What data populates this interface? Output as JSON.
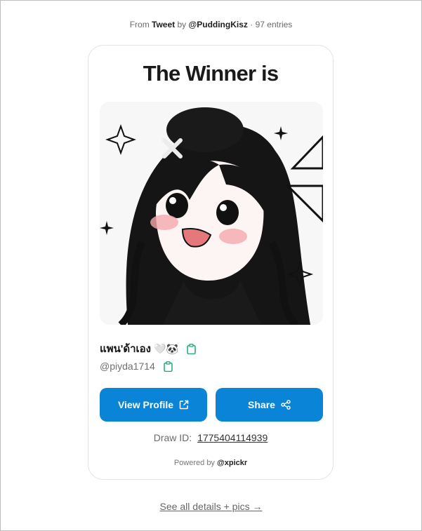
{
  "source": {
    "prefix": "From",
    "link_label": "Tweet",
    "by": "by",
    "author": "@PuddingKisz",
    "separator": "·",
    "entries": "97 entries"
  },
  "card": {
    "title": "The Winner is",
    "winner": {
      "display_name": "แพน'ด้าเอง",
      "emoji": "🤍🐼",
      "handle": "@piyda1714"
    },
    "buttons": {
      "view_profile": "View Profile",
      "share": "Share"
    },
    "draw_id_label": "Draw ID:",
    "draw_id": "1775404114939",
    "powered_prefix": "Powered by",
    "powered_brand": "@xpickr"
  },
  "footer": {
    "details_link": "See all details + pics →"
  },
  "colors": {
    "accent": "#0a84d6",
    "copy_icon": "#1aa97a"
  },
  "icons": [
    "clipboard-icon",
    "external-link-icon",
    "share-icon"
  ]
}
